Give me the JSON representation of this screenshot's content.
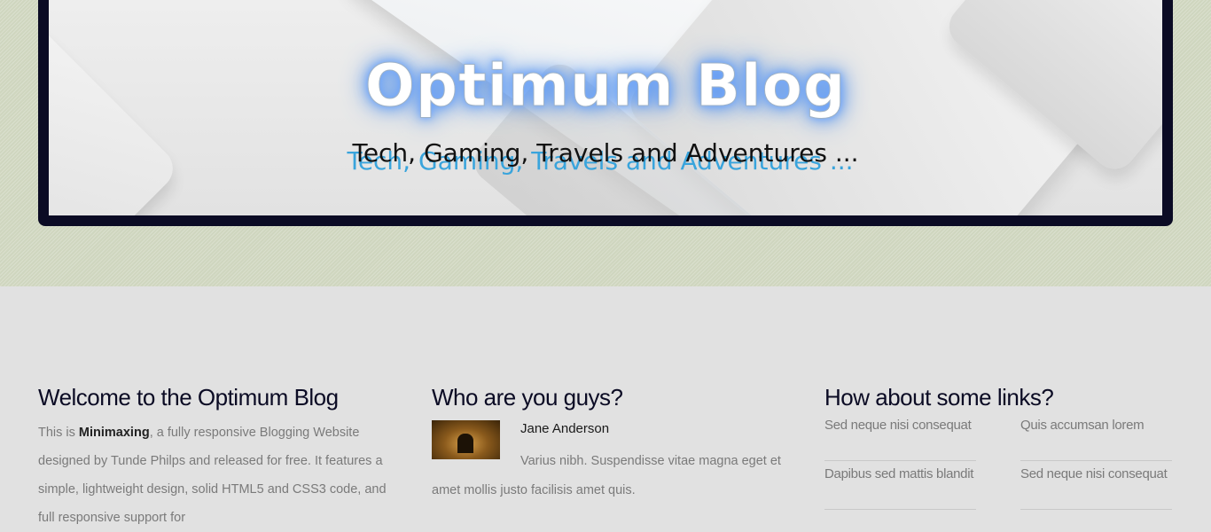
{
  "header": {
    "title": "Optimum Blog",
    "tagline": "Tech, Gaming, Travels and Adventures ..."
  },
  "welcome": {
    "heading": "Welcome to the Optimum Blog",
    "text_before": "This is ",
    "brand": "Minimaxing",
    "text_after": ", a fully responsive Blogging Website designed by Tunde Philps and released for free. It features a simple, lightweight design, solid HTML5 and CSS3 code, and full responsive support for"
  },
  "about": {
    "heading": "Who are you guys?",
    "author_name": "Jane Anderson",
    "author_bio": "Varius nibh. Suspendisse vitae magna eget et amet mollis justo facilisis amet quis."
  },
  "links": {
    "heading": "How about some links?",
    "items": [
      "Sed neque nisi consequat",
      "Quis accumsan lorem",
      "Dapibus sed mattis blandit",
      "Sed neque nisi consequat"
    ]
  },
  "colors": {
    "header_band": "#cfd6bf",
    "banner_frame": "#0b0b24",
    "glow": "#5b96f0",
    "tag_shadow": "#39a4dc",
    "body_bg": "#e1e1e1"
  }
}
